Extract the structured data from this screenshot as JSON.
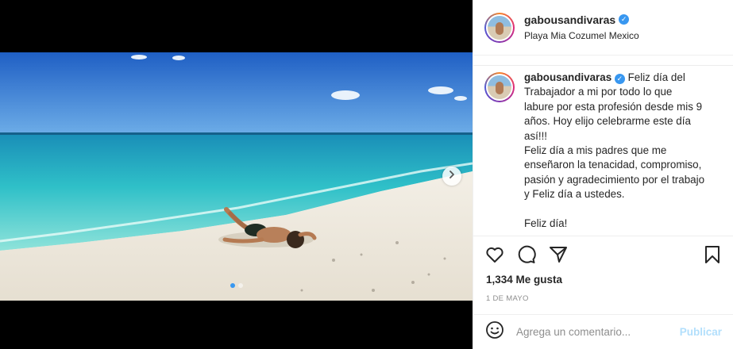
{
  "post": {
    "username": "gabousandivaras",
    "verified": true,
    "location": "Playa Mia Cozumel Mexico",
    "caption_lines": "Feliz día del\nTrabajador a mi por todo lo que\nlabure por esta profesión desde mis 9\naños. Hoy elijo celebrarme este día\nasí!!!\nFeliz día a mis padres que me\nenseñaron la tenacidad, compromiso,\npasión y agradecimiento por el trabajo\ny Feliz día a ustedes.\n\nFeliz día!",
    "likes_text": "1,334 Me gusta",
    "date": "1 DE MAYO"
  },
  "carousel": {
    "slide_count": 2,
    "active_index": 0,
    "next_icon": "chevron-right-icon"
  },
  "actions": {
    "like_icon": "heart-icon",
    "comment_icon": "comment-icon",
    "share_icon": "paper-plane-icon",
    "save_icon": "bookmark-icon"
  },
  "comment": {
    "placeholder": "Agrega un comentario...",
    "submit_label": "Publicar",
    "emoji_icon": "smiley-icon"
  },
  "colors": {
    "accent": "#3897f0",
    "publish_disabled": "#b2dffc",
    "text": "#262626",
    "muted": "#8e8e8e"
  }
}
